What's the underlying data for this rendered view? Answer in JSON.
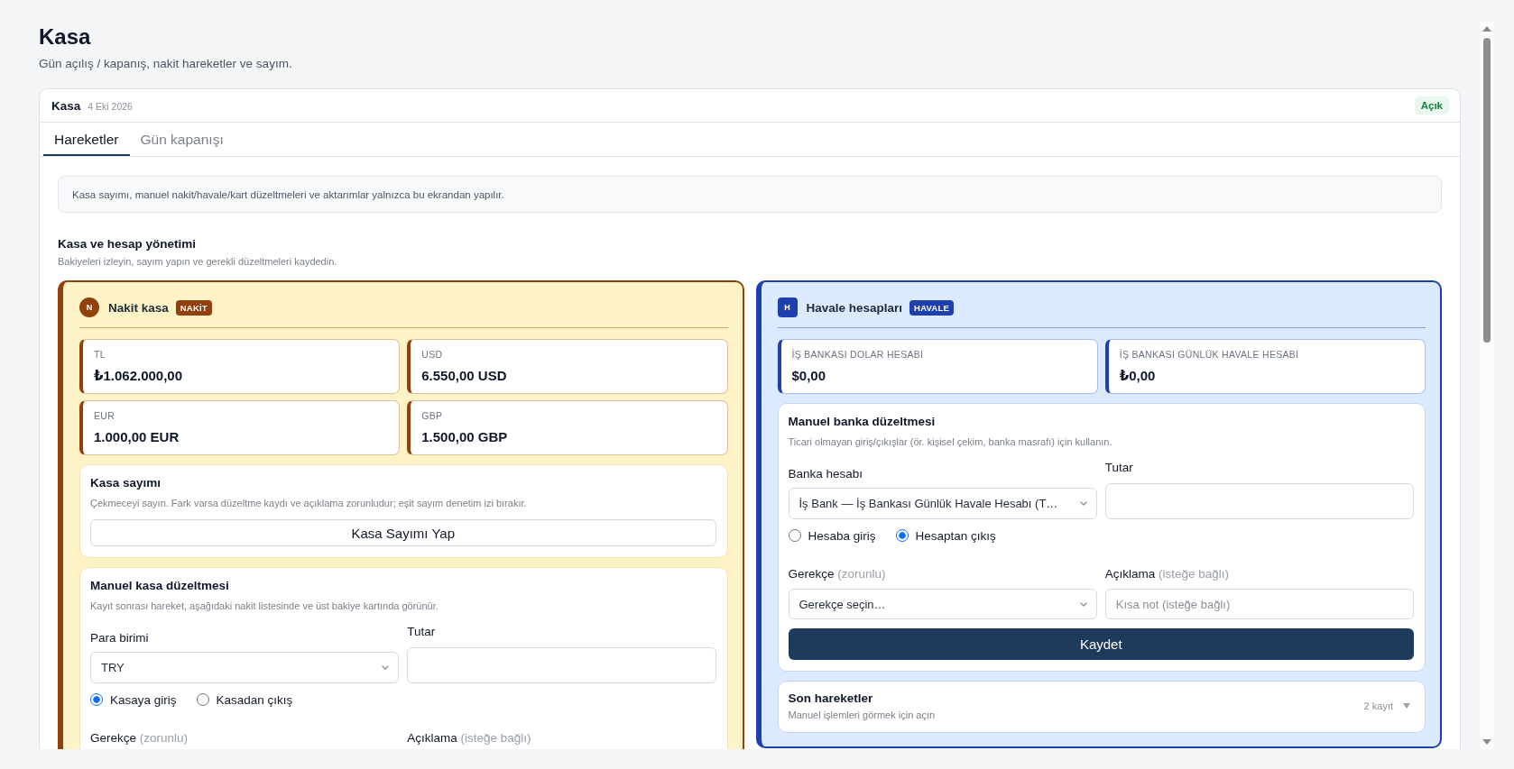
{
  "page": {
    "title": "Kasa",
    "subtitle": "Gün açılış / kapanış, nakit hareketler ve sayım."
  },
  "card": {
    "title": "Kasa",
    "date": "4 Eki 2026",
    "status": {
      "label": "Açık",
      "kind": "open"
    }
  },
  "tabs": [
    {
      "label": "Hareketler",
      "selected": true
    },
    {
      "label": "Gün kapanışı",
      "selected": false
    }
  ],
  "notice": "Kasa sayımı, manuel nakit/havale/kart düzeltmeleri ve aktarımlar yalnızca bu ekrandan yapılır.",
  "section": {
    "title": "Kasa ve hesap yönetimi",
    "subtitle": "Bakiyeleri izleyin, sayım yapın ve gerekli düzeltmeleri kaydedin."
  },
  "panels": [
    {
      "kind": "cash",
      "initial": "N",
      "title": "Nakit kasa",
      "tag": "NAKİT",
      "balances": [
        {
          "label": "TL",
          "amount": "₺1.062.000,00"
        },
        {
          "label": "USD",
          "amount": "6.550,00 USD"
        },
        {
          "label": "EUR",
          "amount": "1.000,00 EUR"
        },
        {
          "label": "GBP",
          "amount": "1.500,00 GBP"
        }
      ],
      "sections": [
        {
          "kind": "count",
          "title": "Kasa sayımı",
          "description": "Çekmeceyi sayın. Fark varsa düzeltme kaydı ve açıklama zorunludur; eşit sayım denetim izi bırakır.",
          "button": "Kasa Sayımı Yap"
        },
        {
          "kind": "adjustment",
          "title": "Manuel kasa düzeltmesi",
          "description": "Kayıt sonrası hareket, aşağıdaki nakit listesinde ve üst bakiye kartında görünür.",
          "rows": [
            {
              "kind": "fields",
              "fields": [
                {
                  "label": "Para birimi",
                  "kind": "select",
                  "value": "TRY"
                },
                {
                  "label": "Tutar",
                  "kind": "input"
                }
              ]
            },
            {
              "kind": "radios",
              "options": [
                {
                  "label": "Kasaya giriş",
                  "selected": true
                },
                {
                  "label": "Kasadan çıkış",
                  "selected": false
                }
              ]
            },
            {
              "kind": "fields",
              "fields": [
                {
                  "label": "Gerekçe",
                  "hint": "(zorunlu)",
                  "kind": "label"
                },
                {
                  "label": "Açıklama",
                  "hint": "(isteğe bağlı)",
                  "kind": "label"
                }
              ]
            }
          ]
        }
      ]
    },
    {
      "kind": "bank",
      "initial": "H",
      "title": "Havale hesapları",
      "tag": "HAVALE",
      "balances": [
        {
          "label": "İŞ BANKASI DOLAR HESABI",
          "amount": "$0,00"
        },
        {
          "label": "İŞ BANKASI GÜNLÜK HAVALE HESABI",
          "amount": "₺0,00"
        }
      ],
      "sections": [
        {
          "kind": "adjustment",
          "title": "Manuel banka düzeltmesi",
          "description": "Ticari olmayan giriş/çıkışlar (ör. kişisel çekim, banka masrafı) için kullanın.",
          "rows": [
            {
              "kind": "fields",
              "fields": [
                {
                  "label": "Banka hesabı",
                  "kind": "select",
                  "value": "İş Bank — İş Bankası Günlük Havale Hesabı (T…"
                },
                {
                  "label": "Tutar",
                  "kind": "input"
                }
              ]
            },
            {
              "kind": "radios",
              "options": [
                {
                  "label": "Hesaba giriş",
                  "selected": false
                },
                {
                  "label": "Hesaptan çıkış",
                  "selected": true
                }
              ]
            },
            {
              "kind": "fields",
              "fields": [
                {
                  "label": "Gerekçe",
                  "hint": "(zorunlu)",
                  "kind": "select",
                  "value": "Gerekçe seçin…"
                },
                {
                  "label": "Açıklama",
                  "hint": "(isteğe bağlı)",
                  "kind": "input",
                  "placeholder": "Kısa not (isteğe bağlı)"
                }
              ]
            },
            {
              "kind": "button",
              "label": "Kaydet"
            }
          ]
        },
        {
          "kind": "collapsible",
          "title": "Son hareketler",
          "description": "Manuel işlemleri görmek için açın",
          "count": "2 kayıt",
          "expanded": false
        }
      ]
    }
  ]
}
